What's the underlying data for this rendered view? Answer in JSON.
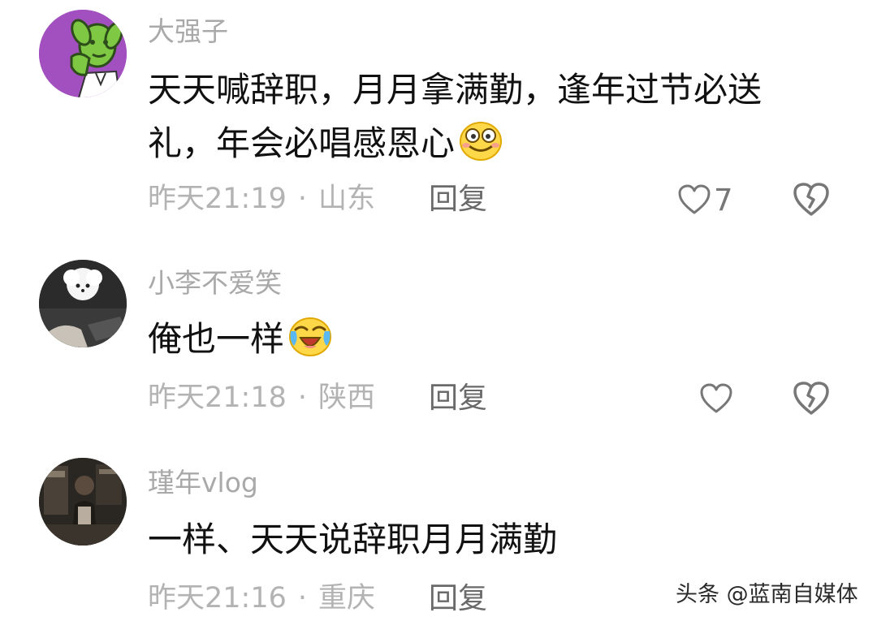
{
  "comments": [
    {
      "username": "大强子",
      "content": "天天喊辞职，月月拿满勤，逢年过节必送礼，年会必唱感恩心",
      "emoji": "smile-emoji",
      "time": "昨天21:19",
      "separator": "·",
      "location": "山东",
      "reply_label": "回复",
      "like_count": "7"
    },
    {
      "username": "小李不爱笑",
      "content": "俺也一样",
      "emoji": "crying-laughing-emoji",
      "time": "昨天21:18",
      "separator": "·",
      "location": "陕西",
      "reply_label": "回复",
      "like_count": ""
    },
    {
      "username": "瑾年vlog",
      "content": "一样、天天说辞职月月满勤",
      "emoji": "",
      "time": "昨天21:16",
      "separator": "·",
      "location": "重庆",
      "reply_label": "回复",
      "like_count": ""
    }
  ],
  "watermark": "头条 @蓝南自媒体",
  "icons": {
    "like": "heart-outline-icon",
    "dislike": "broken-heart-icon"
  },
  "colors": {
    "username": "#a9a9a9",
    "meta": "#b3b3b3",
    "reply": "#6a6a6a",
    "content": "#111111",
    "avatar_1_bg": "#a24fbf"
  }
}
